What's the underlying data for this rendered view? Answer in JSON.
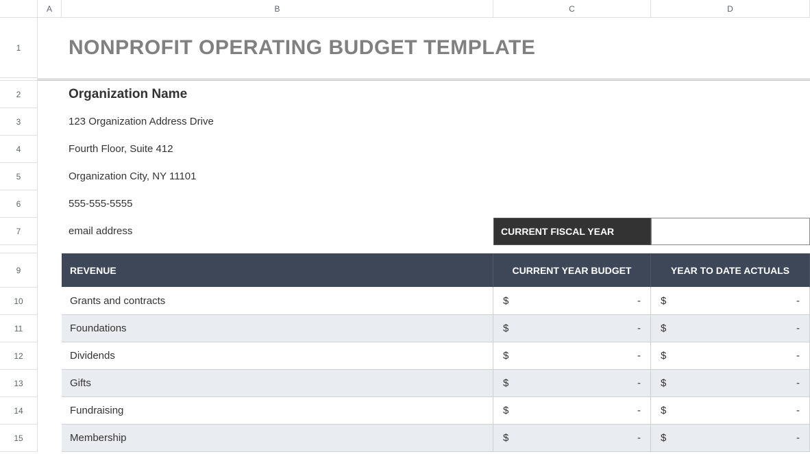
{
  "columns": {
    "A": "A",
    "B": "B",
    "C": "C",
    "D": "D"
  },
  "rows": {
    "1": "1",
    "2": "2",
    "3": "3",
    "4": "4",
    "5": "5",
    "6": "6",
    "7": "7",
    "9": "9",
    "10": "10",
    "11": "11",
    "12": "12",
    "13": "13",
    "14": "14",
    "15": "15"
  },
  "title": "NONPROFIT OPERATING BUDGET TEMPLATE",
  "org": {
    "name": "Organization Name",
    "addr1": "123 Organization Address Drive",
    "addr2": "Fourth Floor, Suite 412",
    "addr3": "Organization City, NY  11101",
    "phone": "555-555-5555",
    "email": "email address"
  },
  "cfy_label": "CURRENT FISCAL YEAR",
  "cfy_value": "",
  "table": {
    "section": "REVENUE",
    "col1": "CURRENT YEAR BUDGET",
    "col2": "YEAR TO DATE ACTUALS",
    "rows": [
      {
        "label": "Grants and contracts",
        "budget_sym": "$",
        "budget_val": "-",
        "actual_sym": "$",
        "actual_val": "-"
      },
      {
        "label": "Foundations",
        "budget_sym": "$",
        "budget_val": "-",
        "actual_sym": "$",
        "actual_val": "-"
      },
      {
        "label": "Dividends",
        "budget_sym": "$",
        "budget_val": "-",
        "actual_sym": "$",
        "actual_val": "-"
      },
      {
        "label": "Gifts",
        "budget_sym": "$",
        "budget_val": "-",
        "actual_sym": "$",
        "actual_val": "-"
      },
      {
        "label": "Fundraising",
        "budget_sym": "$",
        "budget_val": "-",
        "actual_sym": "$",
        "actual_val": "-"
      },
      {
        "label": "Membership",
        "budget_sym": "$",
        "budget_val": "-",
        "actual_sym": "$",
        "actual_val": "-"
      }
    ]
  }
}
